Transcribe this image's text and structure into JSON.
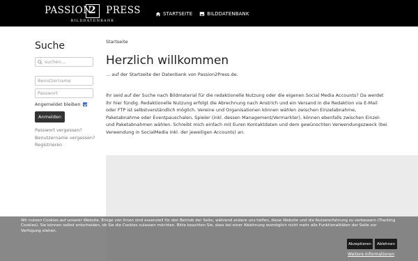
{
  "logo": {
    "word1": "PASSION",
    "number": "2",
    "word2": "PRESS",
    "sub": "BILDDATENBANK"
  },
  "nav": {
    "items": [
      {
        "label": "Startseite",
        "icon": "home-icon"
      },
      {
        "label": "Bilddatenbank",
        "icon": "image-icon"
      }
    ]
  },
  "sidebar": {
    "title": "Suche",
    "search_placeholder": "suchen...",
    "username_placeholder": "Benutzername",
    "password_placeholder": "Passwort",
    "remember_label": "Angemeldet bleiben",
    "remember_checked": true,
    "login_button": "Anmelden",
    "links": [
      "Passwort vergessen?",
      "Benutzername vergessen?",
      "Registrieren"
    ]
  },
  "main": {
    "breadcrumb": "Startseite",
    "title": "Herzlich willkommen",
    "subline": "... auf der Startseite der Datenbank von Passion2Press.de.",
    "intro": "Ihr seid auf der Suche nach Bildmaterial für die redaktionelle Nutzung oder die eigenen Social Media Accounts? Da werdet ihr hier fündig. Redaktionelle Nutzung erfolgt die Abrechnung nach Anstrich und ein Versand in die Redaktion via E-Mail oder FTP ist selbstverständlich möglich. Vereine und Organisationen können wählen zwischen Einzelabnahme, Paketabnahme oder Eventpauschalen, Spieler (inkl. dessen Management/Vermarkter), können ebenfalls zwischen Einzel- und Paketabnahmen wählen. Schreibt mich einfach mit Euren Kontaktdaten und dem gewünschten Verwendungszweck (bei Verwendung in SocialMedia inkl. der jeweiligen Accounts) an."
  },
  "cookie": {
    "text": "Wir nutzen Cookies auf unserer Website. Einige von ihnen sind essenziell für den Betrieb der Seite, während andere uns helfen, diese Website und die Nutzererfahrung zu verbessern (Tracking Cookies). Sie können selbst entscheiden, ob Sie die Cookies zulassen möchten. Bitte beachten Sie, dass bei einer Ablehnung womöglich nicht mehr alle Funktionalitäten der Seite zur Verfügung stehen.",
    "accept": "Akzeptieren",
    "decline": "Ablehnen",
    "more": "Weitere Informationen"
  }
}
